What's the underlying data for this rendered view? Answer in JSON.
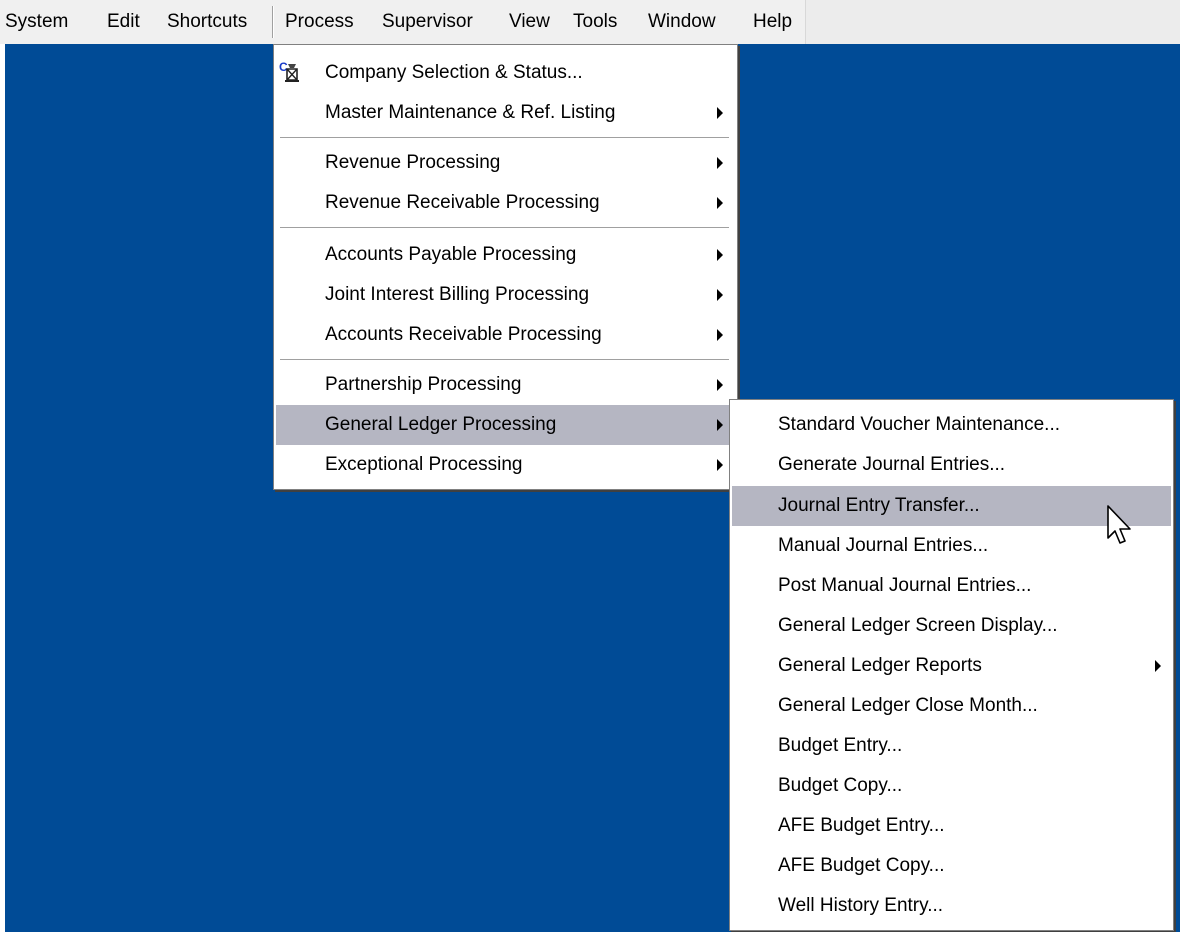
{
  "menubar": {
    "items": [
      {
        "label": "System",
        "underline": "S"
      },
      {
        "label": "Edit",
        "underline": "E"
      },
      {
        "label": "Shortcuts",
        "underline": "c"
      },
      {
        "label": "Process",
        "underline": "P"
      },
      {
        "label": "Supervisor",
        "underline": "u"
      },
      {
        "label": "View",
        "underline": "V"
      },
      {
        "label": "Tools",
        "underline": "T"
      },
      {
        "label": "Window",
        "underline": "W"
      },
      {
        "label": "Help",
        "underline": "H"
      }
    ]
  },
  "process_menu": {
    "items": [
      {
        "label": "Company Selection & Status...",
        "icon": "company-status-icon",
        "submenu": false
      },
      {
        "label": "Master Maintenance & Ref. Listing",
        "submenu": true
      },
      {
        "label": "Revenue Processing",
        "submenu": true
      },
      {
        "label": "Revenue Receivable Processing",
        "submenu": true
      },
      {
        "label": "Accounts Payable Processing",
        "submenu": true
      },
      {
        "label": "Joint Interest Billing Processing",
        "submenu": true
      },
      {
        "label": "Accounts Receivable Processing",
        "submenu": true
      },
      {
        "label": "Partnership Processing",
        "submenu": true
      },
      {
        "label": "General Ledger Processing",
        "submenu": true,
        "highlighted": true
      },
      {
        "label": "Exceptional Processing",
        "submenu": true
      }
    ]
  },
  "gl_menu": {
    "items": [
      {
        "label": "Standard Voucher Maintenance..."
      },
      {
        "label": "Generate Journal Entries..."
      },
      {
        "label": "Journal Entry Transfer...",
        "highlighted": true
      },
      {
        "label": "Manual Journal Entries..."
      },
      {
        "label": "Post Manual Journal Entries..."
      },
      {
        "label": "General Ledger Screen Display..."
      },
      {
        "label": "General Ledger Reports",
        "submenu": true
      },
      {
        "label": "General Ledger Close Month..."
      },
      {
        "label": "Budget Entry..."
      },
      {
        "label": "Budget Copy..."
      },
      {
        "label": "AFE Budget Entry..."
      },
      {
        "label": "AFE Budget Copy..."
      },
      {
        "label": "Well History Entry..."
      }
    ]
  },
  "colors": {
    "desktop": "#004b96",
    "highlight": "#b5b6c2",
    "menubar": "#f0f0f0"
  }
}
